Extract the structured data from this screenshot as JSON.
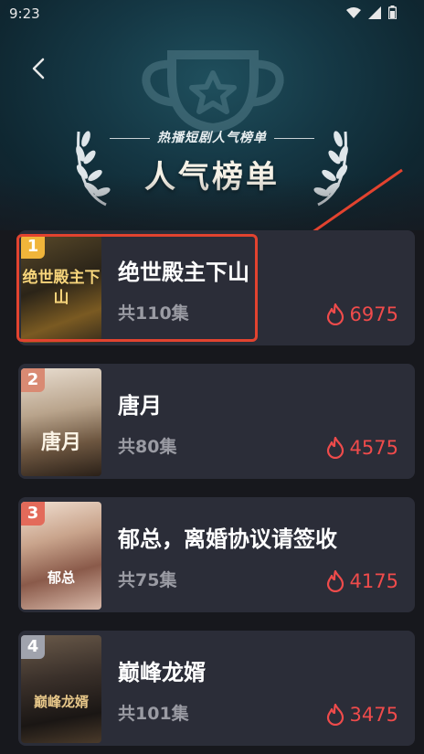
{
  "status": {
    "time": "9:23",
    "icons": [
      "wifi-icon",
      "signal-icon",
      "battery-icon"
    ]
  },
  "header": {
    "subtitle": "热播短剧人气榜单",
    "title": "人气榜单",
    "colors": {
      "bg": "#153845",
      "title": "#f5f1e6"
    }
  },
  "dramas": [
    {
      "rank": "1",
      "title": "绝世殿主下山",
      "episodes": "共110集",
      "heat": "6975",
      "badge_color": "#f0b53a"
    },
    {
      "rank": "2",
      "title": "唐月",
      "episodes": "共80集",
      "heat": "4575",
      "badge_color": "#d98a73"
    },
    {
      "rank": "3",
      "title": "郁总，离婚协议请签收",
      "episodes": "共75集",
      "heat": "4175",
      "badge_color": "#e36a5a"
    },
    {
      "rank": "4",
      "title": "巅峰龙婿",
      "episodes": "共101集",
      "heat": "3475",
      "badge_color": "#a0a3ad"
    }
  ],
  "poster_art": [
    "绝世殿主下山",
    "唐月",
    "郁总",
    "巅峰龙婿"
  ],
  "colors": {
    "heat": "#ef4b4b",
    "card_bg": "#2b2d38",
    "annotation": "#e2432f"
  }
}
